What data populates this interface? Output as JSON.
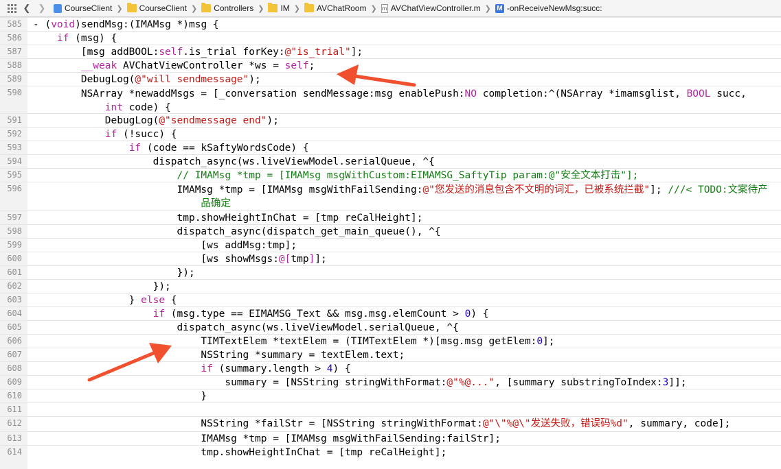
{
  "jumpbar": {
    "crumbs": [
      {
        "label": "CourseClient",
        "icon": "project-icon"
      },
      {
        "label": "CourseClient",
        "icon": "folder-icon"
      },
      {
        "label": "Controllers",
        "icon": "folder-icon"
      },
      {
        "label": "IM",
        "icon": "folder-icon"
      },
      {
        "label": "AVChatRoom",
        "icon": "folder-icon"
      },
      {
        "label": "AVChatViewController.m",
        "icon": "objc-file-icon",
        "badge": "m"
      },
      {
        "label": "-onReceiveNewMsg:succ:",
        "icon": "method-icon",
        "badge": "M"
      }
    ]
  },
  "colors": {
    "keyword": "#b5249f",
    "string": "#c41a16",
    "number": "#1c00cf",
    "comment": "#157d15",
    "arrow": "#f0502d"
  },
  "editor": {
    "lines": [
      {
        "n": "585",
        "t": 0,
        "h": 20,
        "segs": [
          [
            "- (",
            "p"
          ],
          [
            "void",
            "k"
          ],
          [
            ")sendMsg:(IMAMsg *)msg {",
            "p"
          ]
        ]
      },
      {
        "n": "586",
        "t": 20,
        "h": 20,
        "segs": [
          [
            "    ",
            "p"
          ],
          [
            "if",
            "k"
          ],
          [
            " (msg) {",
            "p"
          ]
        ]
      },
      {
        "n": "587",
        "t": 40,
        "h": 20,
        "segs": [
          [
            "        [msg addBOOL:",
            "p"
          ],
          [
            "self",
            "k"
          ],
          [
            ".is_trial forKey:",
            "p"
          ],
          [
            "@\"is_trial\"",
            "s"
          ],
          [
            "];",
            "p"
          ]
        ]
      },
      {
        "n": "588",
        "t": 60,
        "h": 20,
        "segs": [
          [
            "        ",
            "p"
          ],
          [
            "__weak",
            "k"
          ],
          [
            " AVChatViewController *ws = ",
            "p"
          ],
          [
            "self",
            "k"
          ],
          [
            ";",
            "p"
          ]
        ]
      },
      {
        "n": "589",
        "t": 80,
        "h": 20,
        "segs": [
          [
            "        DebugLog(",
            "p"
          ],
          [
            "@\"will sendmessage\"",
            "s"
          ],
          [
            ");",
            "p"
          ]
        ]
      },
      {
        "n": "590",
        "t": 100,
        "h": 40,
        "segs": [
          [
            "        NSArray *newaddMsgs = [_conversation sendMessage:msg enablePush:",
            "p"
          ],
          [
            "NO",
            "k"
          ],
          [
            " completion:^(NSArray *imamsglist, ",
            "p"
          ],
          [
            "BOOL",
            "k"
          ],
          [
            " succ,\n            ",
            "p"
          ],
          [
            "int",
            "k"
          ],
          [
            " code) {",
            "p"
          ]
        ]
      },
      {
        "n": "591",
        "t": 140,
        "h": 20,
        "segs": [
          [
            "            DebugLog(",
            "p"
          ],
          [
            "@\"sendmessage end\"",
            "s"
          ],
          [
            ");",
            "p"
          ]
        ]
      },
      {
        "n": "592",
        "t": 160,
        "h": 20,
        "segs": [
          [
            "            ",
            "p"
          ],
          [
            "if",
            "k"
          ],
          [
            " (!succ) {",
            "p"
          ]
        ]
      },
      {
        "n": "593",
        "t": 180,
        "h": 20,
        "segs": [
          [
            "                ",
            "p"
          ],
          [
            "if",
            "k"
          ],
          [
            " (code == kSaftyWordsCode) {",
            "p"
          ]
        ]
      },
      {
        "n": "594",
        "t": 200,
        "h": 20,
        "segs": [
          [
            "                    dispatch_async(ws.liveViewModel.serialQueue, ^{",
            "p"
          ]
        ]
      },
      {
        "n": "595",
        "t": 220,
        "h": 20,
        "segs": [
          [
            "                        // IMAMsg *tmp = [IMAMsg msgWithCustom:EIMAMSG_SaftyTip param:@\"安全文本打击\"];",
            "c"
          ]
        ]
      },
      {
        "n": "596",
        "t": 240,
        "h": 42,
        "segs": [
          [
            "                        IMAMsg *tmp = [IMAMsg msgWithFailSending:",
            "p"
          ],
          [
            "@\"您发送的消息包含不文明的词汇，已被系统拦截\"",
            "s"
          ],
          [
            "]; ",
            "p"
          ],
          [
            "///< TODO:文案待产\n                            品确定",
            "c"
          ]
        ]
      },
      {
        "n": "597",
        "t": 282,
        "h": 20,
        "segs": [
          [
            "                        tmp.showHeightInChat = [tmp reCalHeight];",
            "p"
          ]
        ]
      },
      {
        "n": "598",
        "t": 302,
        "h": 20,
        "segs": [
          [
            "                        dispatch_async(dispatch_get_main_queue(), ^{",
            "p"
          ]
        ]
      },
      {
        "n": "599",
        "t": 322,
        "h": 20,
        "segs": [
          [
            "                            [ws addMsg:tmp];",
            "p"
          ]
        ]
      },
      {
        "n": "600",
        "t": 342,
        "h": 20,
        "segs": [
          [
            "                            [ws showMsgs:",
            "p"
          ],
          [
            "@[",
            "k"
          ],
          [
            "tmp",
            "p"
          ],
          [
            "]",
            "k"
          ],
          [
            "];",
            "p"
          ]
        ]
      },
      {
        "n": "601",
        "t": 362,
        "h": 20,
        "segs": [
          [
            "                        });",
            "p"
          ]
        ]
      },
      {
        "n": "602",
        "t": 382,
        "h": 20,
        "segs": [
          [
            "                    });",
            "p"
          ]
        ]
      },
      {
        "n": "603",
        "t": 402,
        "h": 20,
        "segs": [
          [
            "                } ",
            "p"
          ],
          [
            "else",
            "k"
          ],
          [
            " {",
            "p"
          ]
        ]
      },
      {
        "n": "604",
        "t": 422,
        "h": 20,
        "segs": [
          [
            "                    ",
            "p"
          ],
          [
            "if",
            "k"
          ],
          [
            " (msg.type == EIMAMSG_Text && msg.msg.elemCount > ",
            "p"
          ],
          [
            "0",
            "n"
          ],
          [
            ") {",
            "p"
          ]
        ]
      },
      {
        "n": "605",
        "t": 442,
        "h": 20,
        "segs": [
          [
            "                        dispatch_async(ws.liveViewModel.serialQueue, ^{",
            "p"
          ]
        ]
      },
      {
        "n": "606",
        "t": 462,
        "h": 20,
        "segs": [
          [
            "                            TIMTextElem *textElem = (TIMTextElem *)[msg.msg getElem:",
            "p"
          ],
          [
            "0",
            "n"
          ],
          [
            "];",
            "p"
          ]
        ]
      },
      {
        "n": "607",
        "t": 482,
        "h": 20,
        "segs": [
          [
            "                            NSString *summary = textElem.text;",
            "p"
          ]
        ]
      },
      {
        "n": "608",
        "t": 502,
        "h": 20,
        "segs": [
          [
            "                            ",
            "p"
          ],
          [
            "if",
            "k"
          ],
          [
            " (summary.length > ",
            "p"
          ],
          [
            "4",
            "n"
          ],
          [
            ") {",
            "p"
          ]
        ]
      },
      {
        "n": "609",
        "t": 522,
        "h": 20,
        "segs": [
          [
            "                                summary = [NSString stringWithFormat:",
            "p"
          ],
          [
            "@\"%@...\"",
            "s"
          ],
          [
            ", [summary substringToIndex:",
            "p"
          ],
          [
            "3",
            "n"
          ],
          [
            "]];",
            "p"
          ]
        ]
      },
      {
        "n": "610",
        "t": 542,
        "h": 20,
        "segs": [
          [
            "                            }",
            "p"
          ]
        ]
      },
      {
        "n": "611",
        "t": 562,
        "h": 20,
        "segs": [
          [
            "",
            "p"
          ]
        ]
      },
      {
        "n": "612",
        "t": 582,
        "h": 22,
        "segs": [
          [
            "                            NSString *failStr = [NSString stringWithFormat:",
            "p"
          ],
          [
            "@\"\\\"%@\\\"发送失败，错误码%d\"",
            "s"
          ],
          [
            ", summary, code];",
            "p"
          ]
        ]
      },
      {
        "n": "613",
        "t": 604,
        "h": 20,
        "segs": [
          [
            "                            IMAMsg *tmp = [IMAMsg msgWithFailSending:failStr];",
            "p"
          ]
        ]
      },
      {
        "n": "614",
        "t": 624,
        "h": 20,
        "segs": [
          [
            "                            tmp.showHeightInChat = [tmp reCalHeight];",
            "p"
          ]
        ]
      }
    ]
  }
}
